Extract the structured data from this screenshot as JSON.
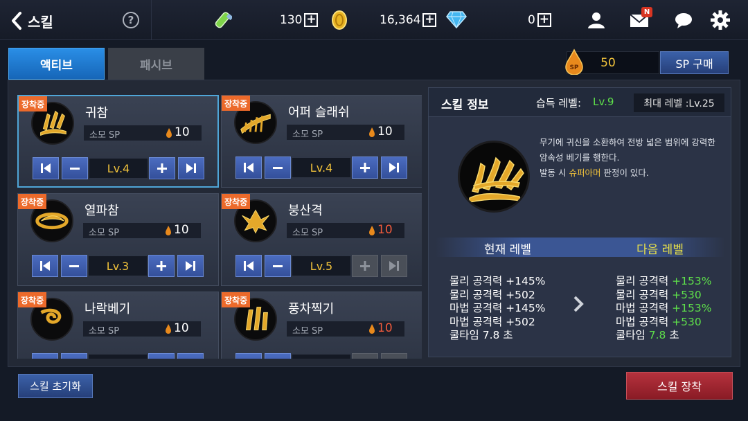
{
  "header": {
    "title": "스킬",
    "help_label": "?",
    "resources": [
      {
        "icon": "vial-icon",
        "value": "130"
      },
      {
        "icon": "gold-coin-icon",
        "value": "16,364"
      },
      {
        "icon": "diamond-icon",
        "value": "0"
      }
    ],
    "mail_badge": "N"
  },
  "tabs": [
    {
      "label": "액티브",
      "active": true
    },
    {
      "label": "패시브",
      "active": false
    }
  ],
  "sp": {
    "label": "SP",
    "value": "50",
    "buy_label": "SP 구매"
  },
  "skills": [
    {
      "name": "귀참",
      "equipped": "장착중",
      "sp_label": "소모 SP",
      "sp_cost": "10",
      "cost_red": false,
      "level": "Lv.4",
      "selected": true
    },
    {
      "name": "어퍼 슬래쉬",
      "equipped": "장착중",
      "sp_label": "소모 SP",
      "sp_cost": "10",
      "cost_red": false,
      "level": "Lv.4",
      "selected": false
    },
    {
      "name": "열파참",
      "equipped": "장착중",
      "sp_label": "소모 SP",
      "sp_cost": "10",
      "cost_red": false,
      "level": "Lv.3",
      "selected": false
    },
    {
      "name": "붕산격",
      "equipped": "장착중",
      "sp_label": "소모 SP",
      "sp_cost": "10",
      "cost_red": true,
      "level": "Lv.5",
      "selected": false,
      "plus_disabled": true
    },
    {
      "name": "나락베기",
      "equipped": "장착중",
      "sp_label": "소모 SP",
      "sp_cost": "10",
      "cost_red": false,
      "level": "",
      "selected": false
    },
    {
      "name": "풍차찍기",
      "equipped": "장착중",
      "sp_label": "소모 SP",
      "sp_cost": "10",
      "cost_red": true,
      "level": "",
      "selected": false,
      "plus_disabled": true
    }
  ],
  "info": {
    "title": "스킬 정보",
    "learn_label": "습득 레벨:",
    "learn_level": "Lv.9",
    "max_level": "최대 레벨 :Lv.25",
    "desc_1": "무기에 귀신을 소환하여 전방 넓은 범위에 강력한 암속성 베기를 행한다.",
    "desc_2_pre": "발동 시 ",
    "desc_2_hl": "슈퍼아머",
    "desc_2_post": " 판정이 있다.",
    "current_label": "현재 레벨",
    "next_label": "다음 레벨",
    "current_stats": [
      {
        "name": "물리 공격력",
        "value": "+145%"
      },
      {
        "name": "물리 공격력",
        "value": "+502"
      },
      {
        "name": "마법 공격력",
        "value": "+145%"
      },
      {
        "name": "마법 공격력",
        "value": "+502"
      },
      {
        "name": "쿨타임",
        "value": "7.8 초"
      }
    ],
    "next_stats": [
      {
        "name": "물리 공격력",
        "value": "+153%"
      },
      {
        "name": "물리 공격력",
        "value": "+530"
      },
      {
        "name": "마법 공격력",
        "value": "+153%"
      },
      {
        "name": "마법 공격력",
        "value": "+530"
      },
      {
        "name": "쿨타임",
        "value": "7.8",
        "unit": "초"
      }
    ]
  },
  "buttons": {
    "reset": "스킬 초기화",
    "equip": "스킬 장착"
  },
  "colors": {
    "accent_blue": "#2a8ee6",
    "gold": "#f2c33b",
    "green": "#5ee04a",
    "red_button": "#b5323d",
    "equip_badge": "#ec6a2b"
  }
}
